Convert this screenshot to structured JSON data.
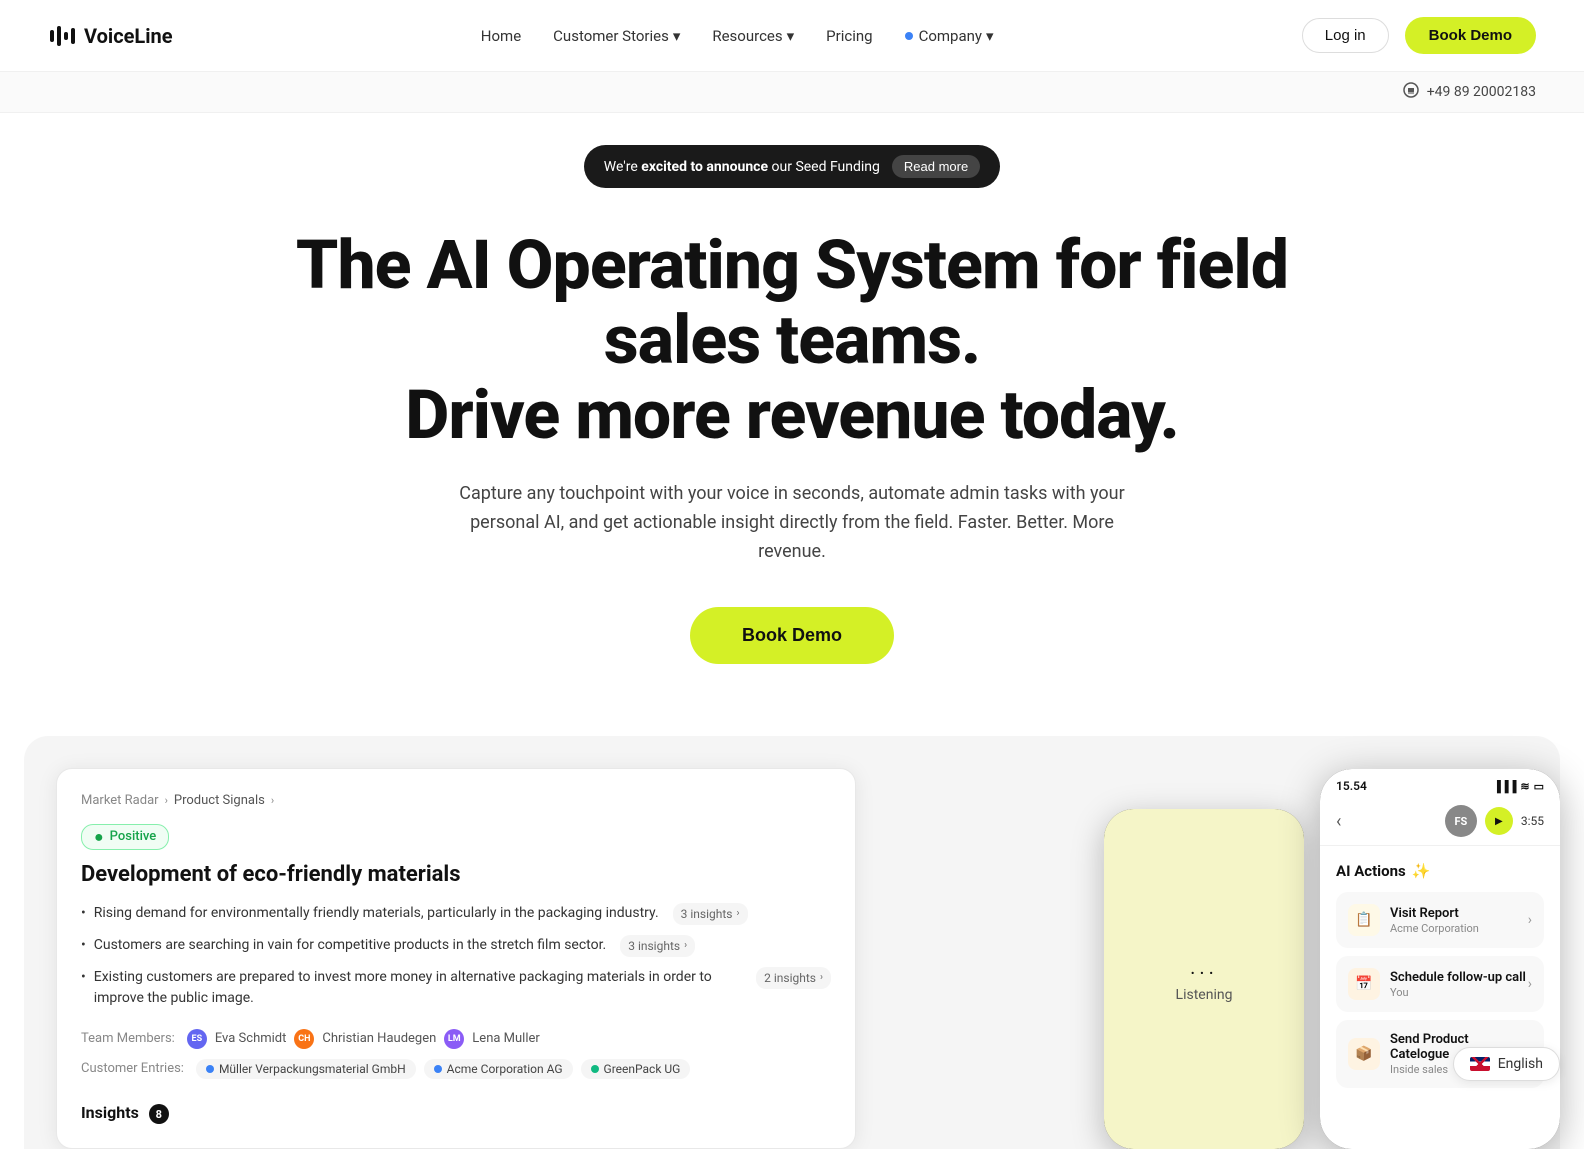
{
  "nav": {
    "logo_text": "VoiceLine",
    "links": [
      {
        "label": "Home",
        "has_dropdown": false
      },
      {
        "label": "Customer Stories",
        "has_dropdown": true
      },
      {
        "label": "Resources",
        "has_dropdown": true
      },
      {
        "label": "Pricing",
        "has_dropdown": false
      },
      {
        "label": "Company",
        "has_dropdown": true,
        "has_dot": true
      }
    ],
    "login_label": "Log in",
    "book_demo_label": "Book Demo",
    "phone": "+49 89 20002183"
  },
  "announcement": {
    "text_regular": "We're ",
    "text_bold": "excited to announce",
    "text_rest": " our Seed Funding",
    "read_more_label": "Read more"
  },
  "hero": {
    "headline_line1": "The AI Operating System for field sales teams.",
    "headline_line2": "Drive more revenue today.",
    "subtext": "Capture any touchpoint with your voice in seconds, automate admin tasks with your personal AI, and get actionable insight directly from the field. Faster. Better. More revenue.",
    "cta_label": "Book Demo"
  },
  "desktop_card": {
    "breadcrumb": [
      {
        "label": "Market Radar"
      },
      {
        "label": "Product Signals"
      }
    ],
    "badge_label": "Positive",
    "title": "Development of eco-friendly materials",
    "bullets": [
      {
        "text": "Rising demand for environmentally friendly materials, particularly in the packaging industry.",
        "insight_count": "3 insights"
      },
      {
        "text": "Customers are searching in vain for competitive products in the stretch film sector.",
        "insight_count": "3 insights"
      },
      {
        "text": "Existing customers are prepared to invest more money in alternative packaging materials in order to improve the public image.",
        "insight_count": "2 insights"
      }
    ],
    "team_label": "Team Members:",
    "members": [
      {
        "name": "Eva Schmidt",
        "color": "#6366f1"
      },
      {
        "name": "Christian Haudegen",
        "color": "#f97316"
      },
      {
        "name": "Lena Muller",
        "color": "#8b5cf6"
      }
    ],
    "customer_label": "Customer Entries:",
    "customers": [
      {
        "name": "Müller Verpackungsmaterial GmbH",
        "color": "#3b82f6"
      },
      {
        "name": "Acme Corporation AG",
        "color": "#3b82f6"
      },
      {
        "name": "GreenPack UG",
        "color": "#10b981"
      }
    ],
    "insights_label": "Insights",
    "insights_count": "8"
  },
  "phone_mid": {
    "dots": "...",
    "label": "Listening"
  },
  "phone_right": {
    "time": "15.54",
    "avatar_initials": "FS",
    "duration": "3:55",
    "ai_actions_title": "AI Actions",
    "actions": [
      {
        "icon": "📋",
        "icon_bg": "#fef9e7",
        "title": "Visit Report",
        "subtitle": "Acme Corporation"
      },
      {
        "icon": "📅",
        "icon_bg": "#fef3e2",
        "title": "Schedule follow-up call",
        "subtitle": "You"
      },
      {
        "icon": "📦",
        "icon_bg": "#fef3e2",
        "title": "Send Product Catelogue",
        "subtitle": "Inside sales"
      }
    ]
  },
  "visit_report": {
    "title": "Visit Report Acme Corporation",
    "subtitle": "Visit Report"
  },
  "language": {
    "label": "English"
  }
}
